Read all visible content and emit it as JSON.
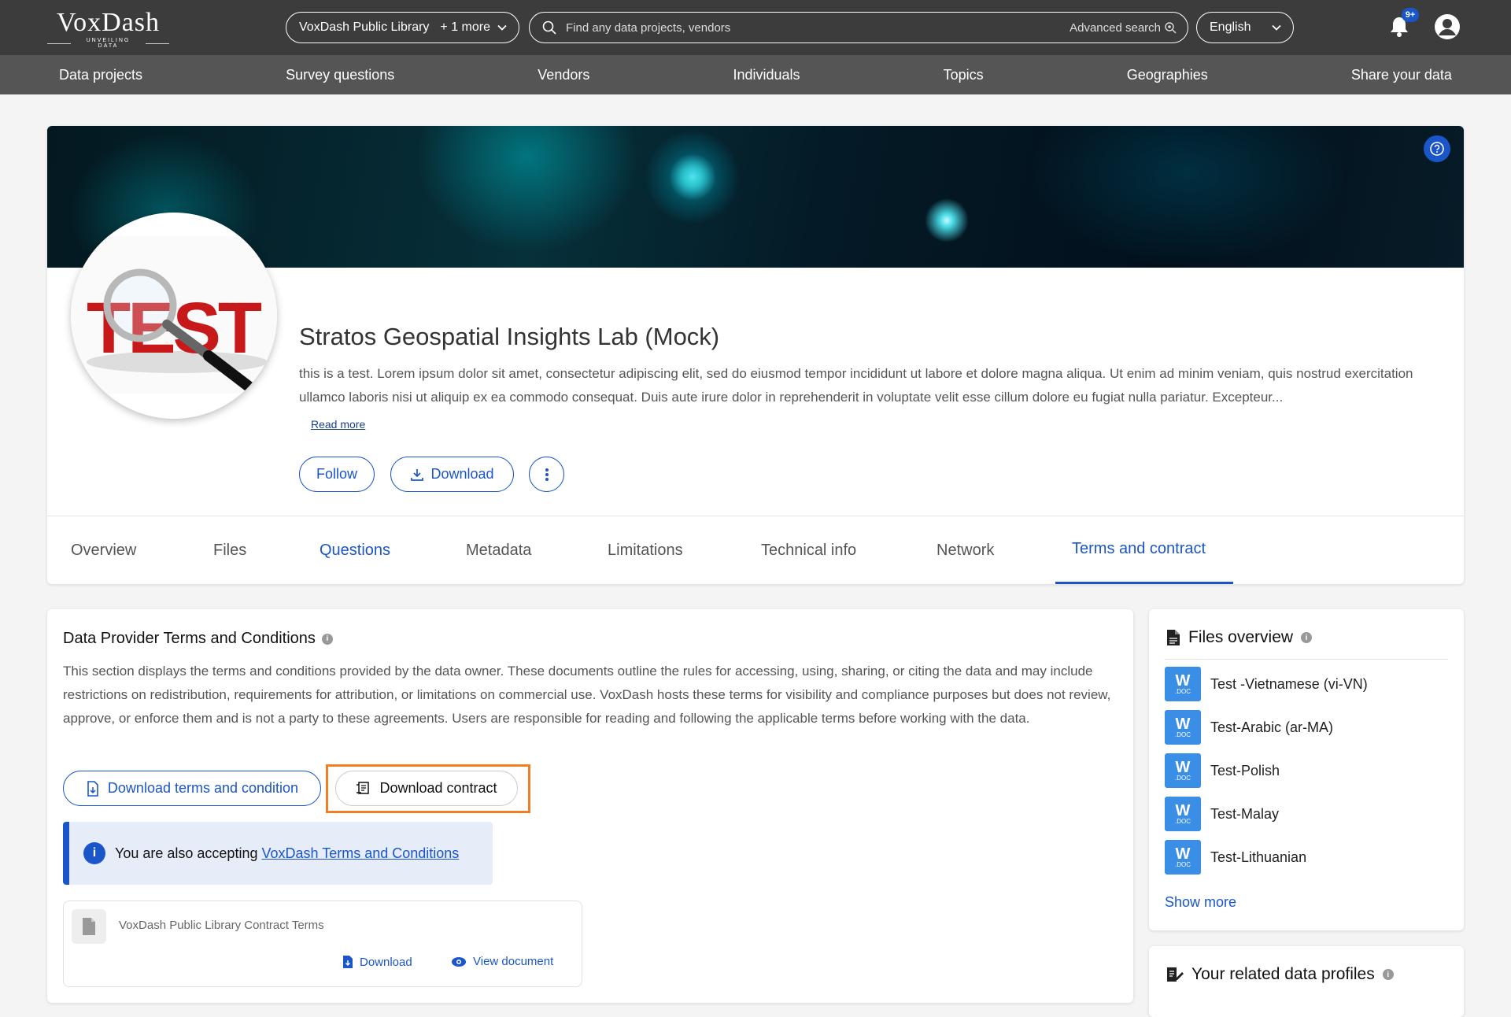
{
  "header": {
    "logo_word": "VoxDash",
    "logo_tagline": "UNVEILING DATA",
    "library": {
      "label": "VoxDash Public Library",
      "more": "+ 1 more"
    },
    "search": {
      "placeholder": "Find any data projects, vendors",
      "advanced": "Advanced search"
    },
    "language": "English",
    "notification_badge": "9+"
  },
  "nav": [
    "Data projects",
    "Survey questions",
    "Vendors",
    "Individuals",
    "Topics",
    "Geographies",
    "Share your data"
  ],
  "profile": {
    "title": "Stratos Geospatial Insights Lab (Mock)",
    "description": "this is a test. Lorem ipsum dolor sit amet, consectetur adipiscing elit, sed do eiusmod tempor incididunt ut labore et dolore magna aliqua. Ut enim ad minim veniam, quis nostrud exercitation ullamco laboris nisi ut aliquip ex ea commodo consequat. Duis aute irure dolor in reprehenderit in voluptate velit esse cillum dolore eu fugiat nulla pariatur. Excepteur...",
    "read_more": "Read more",
    "logo_text": "TEST",
    "follow": "Follow",
    "download": "Download"
  },
  "tabs": [
    "Overview",
    "Files",
    "Questions",
    "Metadata",
    "Limitations",
    "Technical info",
    "Network",
    "Terms and contract"
  ],
  "terms": {
    "heading": "Data Provider Terms and Conditions",
    "body": "This section displays the terms and conditions provided by the data owner. These documents outline the rules for accessing, using, sharing, or citing the data and may include restrictions on redistribution, requirements for attribution, or limitations on commercial use. VoxDash hosts these terms for visibility and compliance purposes but does not review, approve, or enforce them and is not a party to these agreements. Users are responsible for reading and following the applicable terms before working with the data.",
    "download_terms": "Download terms and condition",
    "download_contract": "Download contract",
    "notice_prefix": "You are also accepting",
    "notice_link": "VoxDash Terms and Conditions",
    "doc_name": "VoxDash Public Library Contract Terms",
    "doc_download": "Download",
    "doc_view": "View document"
  },
  "files_overview": {
    "heading": "Files overview",
    "files": [
      "Test -Vietnamese (vi-VN)",
      "Test-Arabic (ar-MA)",
      "Test-Polish",
      "Test-Malay",
      "Test-Lithuanian"
    ],
    "file_icon_letter": "W",
    "file_icon_ext": ".DOC",
    "show_more": "Show more"
  },
  "related": {
    "heading": "Your related data profiles"
  }
}
